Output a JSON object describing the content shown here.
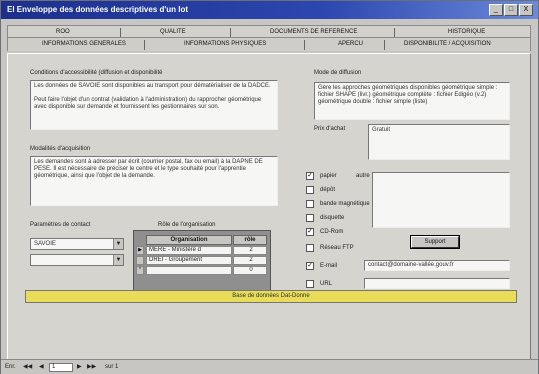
{
  "window": {
    "title": "El Enveloppe des données descriptives d'un lot",
    "controls": [
      "_",
      "□",
      "X"
    ]
  },
  "tabs": {
    "row1": [
      "ROO",
      "QUALITE",
      "DOCUMENTS DE REFERENCE",
      "HISTORIQUE"
    ],
    "row2": [
      "INFORMATIONS GENERALES",
      "INFORMATIONS PHYSIQUES",
      "APERCU",
      "DISPONIBILITE / ACQUISITION"
    ]
  },
  "conditions": {
    "label": "Conditions d'accessibilité (diffusion et disponibilité",
    "text": "Les données de SAVOIE sont disponibles au transport pour dématérialiser de la DADCE.\n\nPeut faire l'objet d'un contrat (validation à l'administration) du rapprocher géométrique avec disponible sur demande et fournissent les gestionnaires sur son."
  },
  "modalites": {
    "label": "Modalités d'acquisition",
    "text": "Les demandes sont à adresser par écrit (courrier postal, fax ou email) à la DAPNE DE PESE. Il est nécessaire de préciser le centre et le type souhaité pour l'apprentie géométrique, ainsi que l'objet de la demande."
  },
  "parametres": {
    "label": "Paramètres de contact",
    "combo1": "SAVOIE",
    "combo2": ""
  },
  "role": {
    "label": "Rôle de l'organisation",
    "headers": [
      "Organisation",
      "rôle"
    ],
    "rows": [
      {
        "org": "MERE - Ministère d",
        "role": "2"
      },
      {
        "org": "DREI - Groupement",
        "role": "2"
      },
      {
        "org": "",
        "role": "0"
      }
    ]
  },
  "mode": {
    "label": "Mode de diffusion",
    "text": "Gère les approches géométriques disponibles géométrique simple : fichier SHAPE (livr.) géométrique complète : fichier Edigéo (v.2) géométrique double : fichier simple (liste)"
  },
  "prix": {
    "label": "Prix d'achat",
    "value": "Gratuit"
  },
  "supports": {
    "items": [
      {
        "label": "papier",
        "checked": true
      },
      {
        "label": "dépôt",
        "checked": false
      },
      {
        "label": "bande magnétique",
        "checked": false
      },
      {
        "label": "disquette",
        "checked": false
      },
      {
        "label": "CD-Rom",
        "checked": true
      },
      {
        "label": "Réseau FTP",
        "checked": false
      },
      {
        "label": "E-mail",
        "checked": true,
        "value": "contact@domaine-vallée.gouv.fr"
      },
      {
        "label": "URL",
        "checked": false,
        "value": ""
      }
    ],
    "autre_label": "autre",
    "support_button": "Support"
  },
  "bottom_bar": "Base de données Dat-Donne",
  "status": {
    "record_label": "Enr.",
    "record_index": "1",
    "record_total": "sur 1"
  }
}
